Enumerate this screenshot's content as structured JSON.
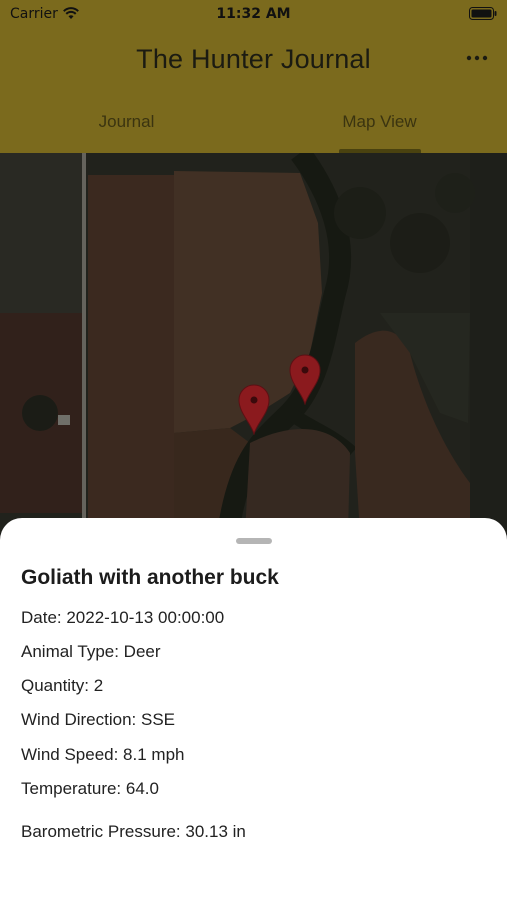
{
  "status_bar": {
    "carrier": "Carrier",
    "time": "11:32 AM",
    "wifi_icon": "wifi-icon",
    "battery_icon": "battery-icon"
  },
  "header": {
    "title": "The Hunter Journal",
    "menu_icon": "more-horizontal-icon",
    "background_color": "#7b6a1d"
  },
  "tabs": [
    {
      "label": "Journal",
      "selected": false
    },
    {
      "label": "Map View",
      "selected": true
    }
  ],
  "map": {
    "type": "satellite",
    "pins": [
      {
        "name": "map-pin",
        "color": "#8b1a1e"
      },
      {
        "name": "map-pin",
        "color": "#8b1a1e"
      }
    ]
  },
  "detail_sheet": {
    "title": "Goliath with another buck",
    "fields": [
      "Date: 2022-10-13 00:00:00",
      "Animal Type: Deer",
      "Quantity: 2",
      "Wind Direction: SSE",
      "Wind Speed: 8.1 mph",
      "Temperature: 64.0",
      "Barometric Pressure: 30.13 in"
    ]
  }
}
